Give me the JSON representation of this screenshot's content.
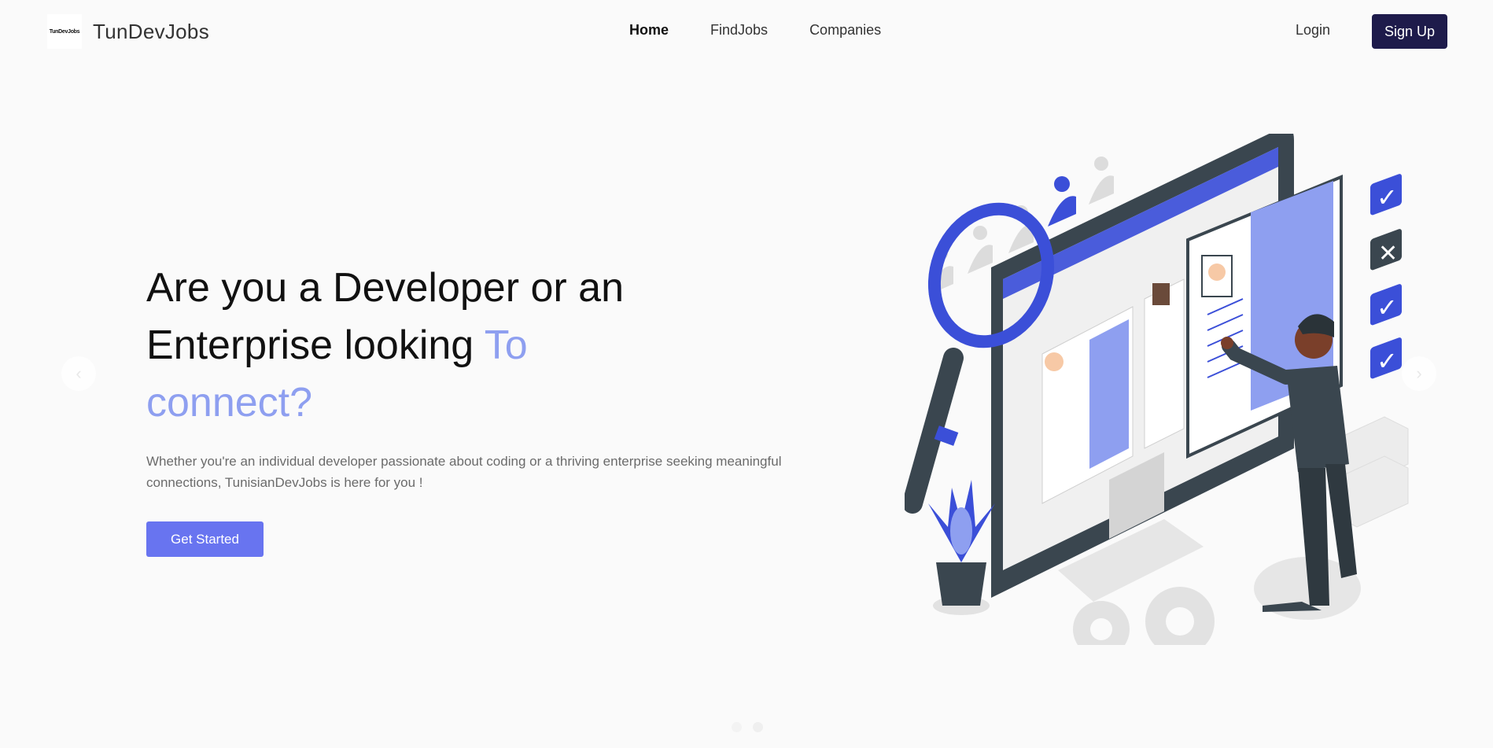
{
  "brand": {
    "logo_text": "TunDevJobs",
    "name": "TunDevJobs"
  },
  "nav": {
    "links": [
      {
        "label": "Home",
        "active": true
      },
      {
        "label": "FindJobs",
        "active": false
      },
      {
        "label": "Companies",
        "active": false
      }
    ],
    "login_label": "Login",
    "signup_label": "Sign Up"
  },
  "hero": {
    "headline_line1": "Are you a Developer or an",
    "headline_line2": "Enterprise looking ",
    "headline_accent_1": "To",
    "headline_accent_2": "connect?",
    "subtitle": "Whether you're an individual developer passionate about coding or a thriving enterprise seeking meaningful connections, TunisianDevJobs is here for you !",
    "cta_label": "Get Started"
  },
  "carousel": {
    "prev_icon": "chevron-left-icon",
    "next_icon": "chevron-right-icon",
    "slide_count": 2,
    "active_slide": 1
  },
  "colors": {
    "background": "#fafafa",
    "accent_text": "#8e9ff0",
    "cta": "#6874f0",
    "signup_bg": "#1e1b4b",
    "illustration_blue": "#3b4fd8",
    "illustration_dark": "#3a464f"
  }
}
